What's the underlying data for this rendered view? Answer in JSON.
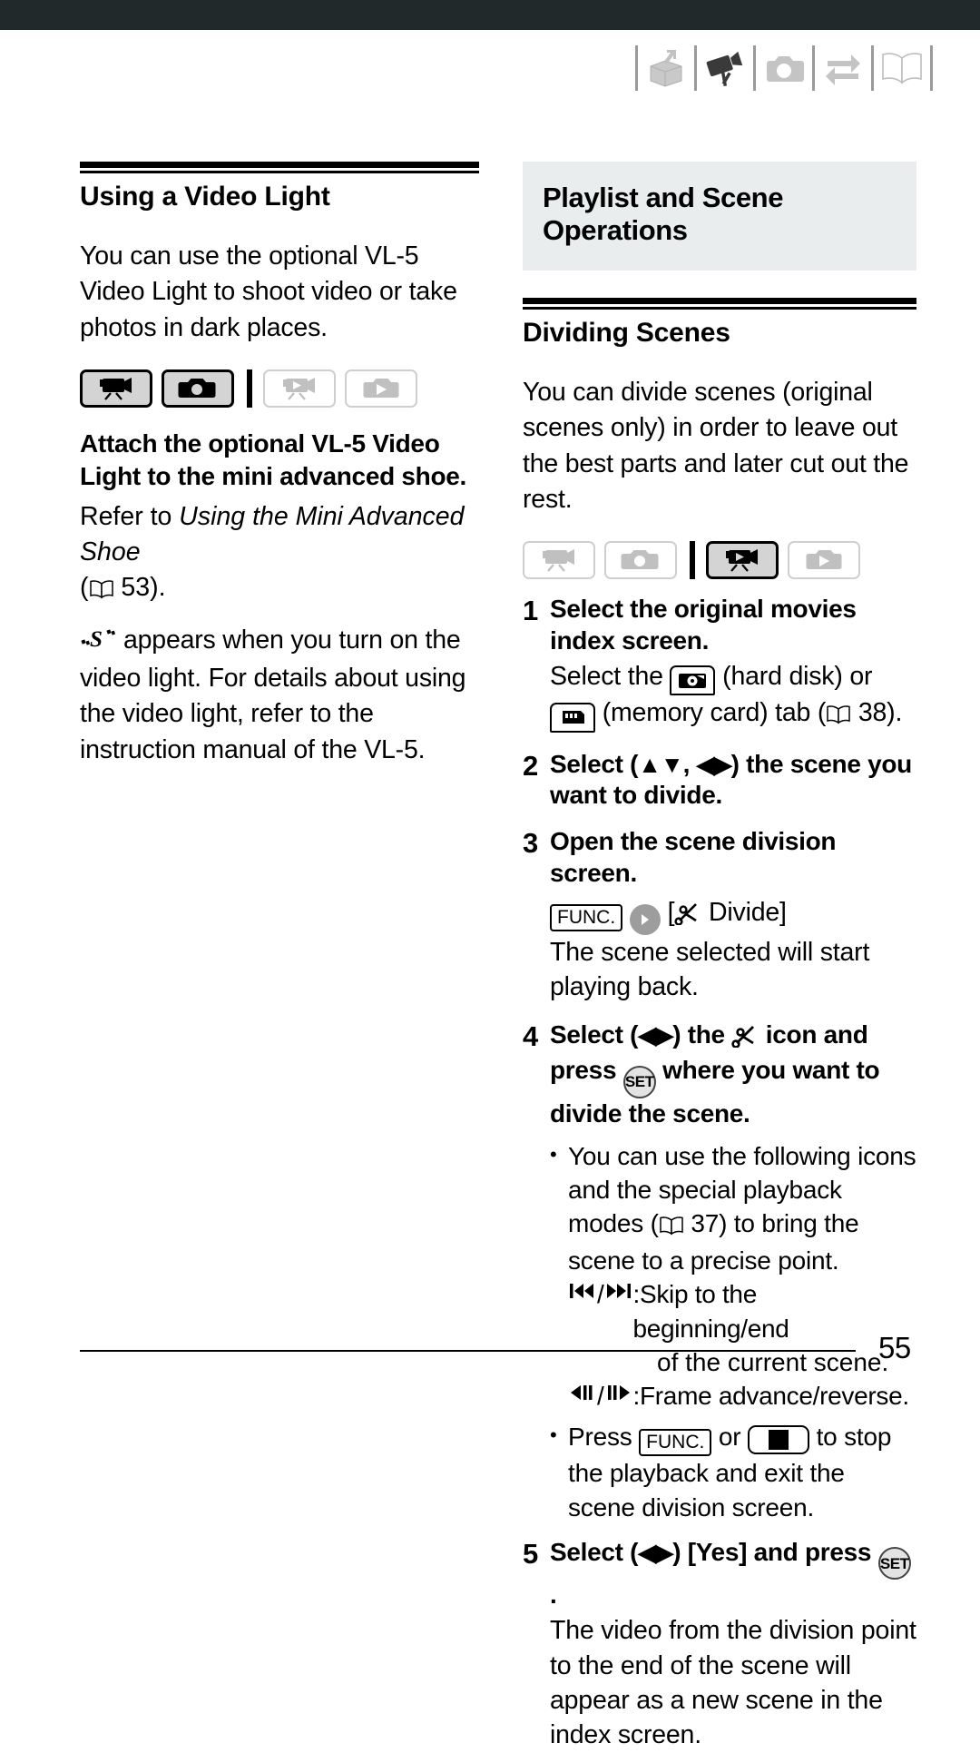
{
  "page": {
    "number": "55"
  },
  "header_icons": [
    {
      "name": "unpacking-box-icon",
      "state": "inactive"
    },
    {
      "name": "camcorder-icon",
      "state": "active"
    },
    {
      "name": "camera-icon",
      "state": "inactive"
    },
    {
      "name": "exchange-arrows-icon",
      "state": "inactive"
    },
    {
      "name": "open-book-icon",
      "state": "inactive"
    }
  ],
  "left_column": {
    "section_title": "Using a Video Light",
    "intro": "You can use the optional VL-5 Video Light to shoot video or take photos in dark places.",
    "mode_icons": [
      {
        "name": "movie-record-mode",
        "state": "on"
      },
      {
        "name": "photo-record-mode",
        "state": "on"
      },
      {
        "name": "movie-playback-mode",
        "state": "off"
      },
      {
        "name": "photo-playback-mode",
        "state": "off"
      }
    ],
    "bold_instruction": "Attach the optional VL-5 Video Light to the mini advanced shoe.",
    "refer_prefix": "Refer to ",
    "refer_italic": "Using the Mini Advanced Shoe",
    "refer_open_paren": "(",
    "refer_page": "53",
    "refer_close": ").",
    "light_note_after_symbol": "appears when you turn on the video light. For details about using the video light, refer to the instruction manual of the VL-5."
  },
  "right_column": {
    "banner_title": "Playlist and Scene Operations",
    "section_title": "Dividing Scenes",
    "intro": "You can divide scenes (original scenes only) in order to leave out the best parts and later cut out the rest.",
    "mode_icons": [
      {
        "name": "movie-record-mode",
        "state": "off"
      },
      {
        "name": "photo-record-mode",
        "state": "off"
      },
      {
        "name": "movie-playback-mode",
        "state": "on"
      },
      {
        "name": "photo-playback-mode",
        "state": "off"
      }
    ],
    "steps": [
      {
        "num": "1",
        "title": "Select the original movies index screen.",
        "body_part1": "Select the ",
        "body_part2": " (hard disk) or ",
        "body_part3": " (memory card) tab (",
        "body_page": "38",
        "body_part4": ")."
      },
      {
        "num": "2",
        "title_part1": "Select (",
        "title_arrows1": "▲▼",
        "title_part2": ", ",
        "title_arrows2": "◀▶",
        "title_part3": ") the scene you want to divide."
      },
      {
        "num": "3",
        "title": "Open the scene division screen.",
        "func_label": "FUNC.",
        "bracket_open": "[",
        "divide_label": "Divide",
        "bracket_close": "]",
        "body": "The scene selected will start playing back."
      },
      {
        "num": "4",
        "title_part1": "Select (",
        "title_arrows": "◀▶",
        "title_part2": ") the ",
        "title_part3": " icon and press ",
        "set_label": "SET",
        "title_part4": " where you want to divide the scene."
      },
      {
        "num": "5",
        "title_part1": "Select (",
        "title_arrows": "◀▶",
        "title_part2": ") [Yes] and press ",
        "set_label": "SET",
        "title_part3": ".",
        "body": "The video from the division point to the end of the scene will appear as a new scene in the index screen."
      }
    ],
    "bullets": {
      "first_part1": "You can use the following icons and the special playback modes (",
      "first_page": "37",
      "first_part2": ") to bring the scene to a precise point.",
      "skip_label": ":Skip to the beginning/end",
      "skip_label_line2": "of the current scene.",
      "frame_label": ":Frame advance/reverse.",
      "second_part1": "Press ",
      "second_func": "FUNC.",
      "second_part2": " or ",
      "second_part3": " to stop the playback and exit the scene division screen."
    }
  },
  "colors": {
    "topbar": "#22292a",
    "banner_bg": "#e9edee",
    "mode_on_fill": "#d4d4d4",
    "icon_gray": "#b4b4b4"
  }
}
